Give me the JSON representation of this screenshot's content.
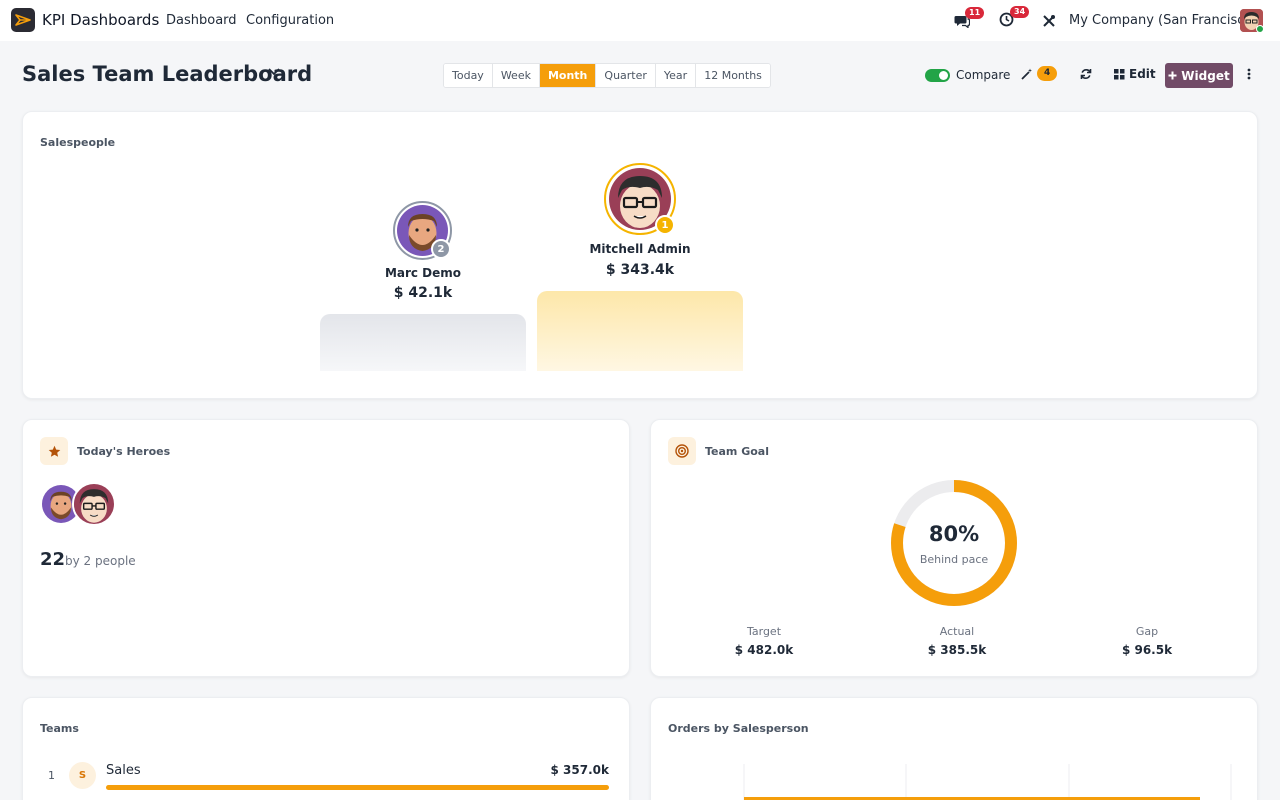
{
  "navbar": {
    "app_name": "KPI Dashboards",
    "menu": [
      "Dashboard",
      "Configuration"
    ],
    "messages_count": "11",
    "activities_count": "34",
    "company": "My Company (San Francisco)"
  },
  "toolbar": {
    "title": "Sales Team Leaderboard",
    "periods": [
      "Today",
      "Week",
      "Month",
      "Quarter",
      "Year",
      "12 Months"
    ],
    "active_period": "Month",
    "compare_label": "Compare",
    "compare_enabled": true,
    "suggestions_count": "4",
    "edit_label": "Edit",
    "widget_label": "Widget"
  },
  "salespeople": {
    "title": "Salespeople",
    "podium": [
      {
        "rank": "1",
        "name": "Mitchell Admin",
        "amount": "$ 343.4k"
      },
      {
        "rank": "2",
        "name": "Marc Demo",
        "amount": "$ 42.1k"
      }
    ]
  },
  "heroes": {
    "title": "Today's Heroes",
    "count": "22",
    "suffix": "by 2 people"
  },
  "goal": {
    "title": "Team Goal",
    "percent_label": "80%",
    "percent": 80,
    "status": "Behind pace",
    "target_label": "Target",
    "target_value": "$ 482.0k",
    "actual_label": "Actual",
    "actual_value": "$ 385.5k",
    "gap_label": "Gap",
    "gap_value": "$ 96.5k"
  },
  "teams": {
    "title": "Teams",
    "rows": [
      {
        "rank": "1",
        "initial": "S",
        "name": "Sales",
        "value": "$ 357.0k",
        "share": 1.0
      }
    ]
  },
  "orders": {
    "title": "Orders by Salesperson"
  },
  "colors": {
    "accent": "#f59e0b",
    "brand": "#714b67",
    "success": "#22a447",
    "danger": "#d9283a"
  }
}
